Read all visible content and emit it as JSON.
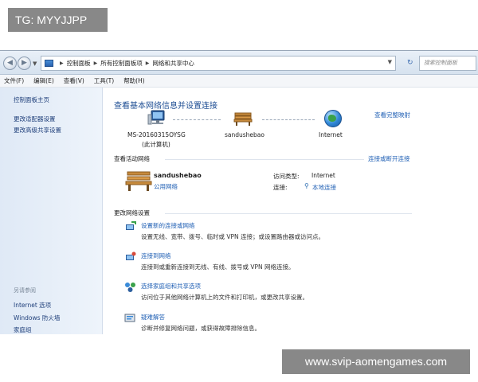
{
  "watermarks": {
    "top": "TG: MYYJJPP",
    "bottom": "www.svip-aomengames.com"
  },
  "address_bar": {
    "crumbs": [
      "控制面板",
      "所有控制面板项",
      "网络和共享中心"
    ],
    "search_placeholder": "搜索控制面板"
  },
  "menu": [
    "文件(F)",
    "编辑(E)",
    "查看(V)",
    "工具(T)",
    "帮助(H)"
  ],
  "sidebar": {
    "top_links": [
      "控制面板主页",
      "更改适配器设置",
      "更改高级共享设置"
    ],
    "see_also_title": "另请参阅",
    "see_also_links": [
      "Internet 选项",
      "Windows 防火墙",
      "家庭组"
    ]
  },
  "main": {
    "title": "查看基本网络信息并设置连接",
    "full_map_link": "查看完整映射",
    "map": {
      "computer_name": "MS-20160315OYSG",
      "computer_sub": "(此计算机)",
      "network_name": "sandushebao",
      "internet_label": "Internet"
    },
    "active_networks": {
      "heading": "查看活动网络",
      "connect_link": "连接或断开连接",
      "network_name": "sandushebao",
      "network_type": "公用网络",
      "access_type_label": "访问类型:",
      "access_type_value": "Internet",
      "connections_label": "连接:",
      "connections_value": "本地连接"
    },
    "change_settings": {
      "heading": "更改网络设置",
      "tasks": [
        {
          "title": "设置新的连接或网络",
          "desc": "设置无线、宽带、拨号、临时或 VPN 连接；或设置路由器或访问点。"
        },
        {
          "title": "连接到网络",
          "desc": "连接到或重新连接到无线、有线、拨号或 VPN 网络连接。"
        },
        {
          "title": "选择家庭组和共享选项",
          "desc": "访问位于其他网络计算机上的文件和打印机，或更改共享设置。"
        },
        {
          "title": "疑难解答",
          "desc": "诊断并修复网络问题，或获得故障排除信息。"
        }
      ]
    }
  },
  "colors": {
    "link": "#1f5fb4",
    "title": "#1d4d93",
    "sidebar_bg": "#dfe9f6"
  }
}
